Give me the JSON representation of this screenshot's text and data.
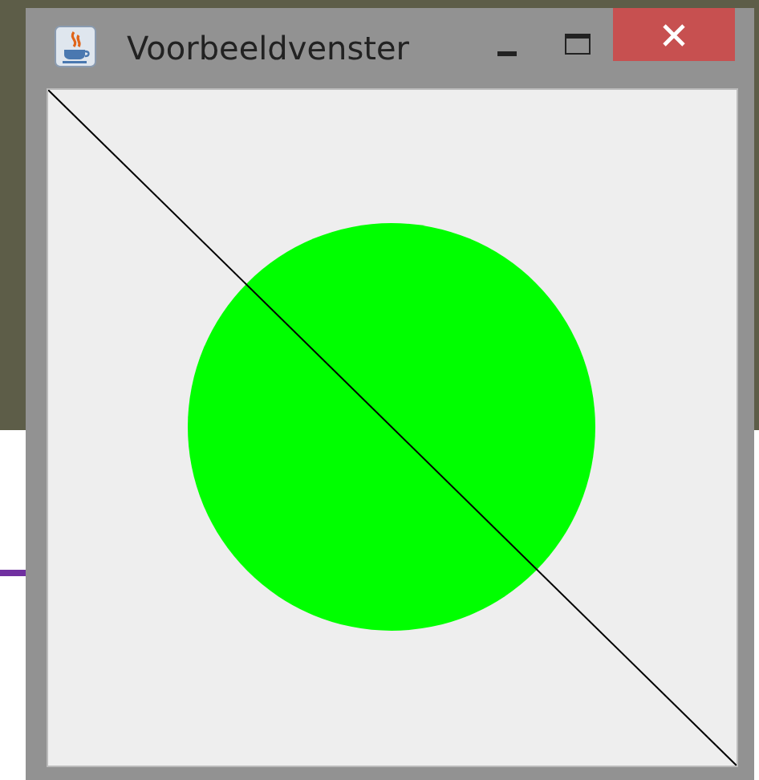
{
  "window": {
    "title": "Voorbeeldvenster"
  }
}
